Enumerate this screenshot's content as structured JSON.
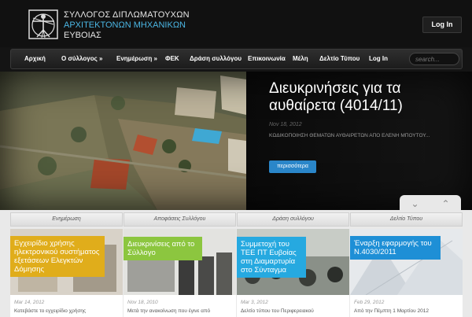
{
  "header": {
    "brand_line1": "ΣΥΛΛΟΓΟΣ ΔΙΠΛΩΜΑΤΟΥΧΩΝ",
    "brand_line2": "ΑΡΧΙΤΕΚΤΟΝΩΝ ΜΗΧΑΝΙΚΩΝ",
    "brand_line3": "ΕΥΒΟΙΑΣ",
    "login_label": "Log In"
  },
  "nav": {
    "items": [
      {
        "label": "Αρχική"
      },
      {
        "label": "Ο σύλλογος »"
      },
      {
        "label": "Ενημέρωση »"
      },
      {
        "label": "ΦΕΚ"
      },
      {
        "label": "Δράση συλλόγου"
      },
      {
        "label": "Επικοινωνία"
      },
      {
        "label": "Μέλη"
      },
      {
        "label": "Δελτίο Τύπου"
      },
      {
        "label": "Log In"
      }
    ],
    "search_placeholder": "search..."
  },
  "hero": {
    "title": "Διευκρινήσεις για τα αυθαίρετα (4014/11)",
    "date": "Nov 18, 2012",
    "excerpt": "ΚΩΔΙΚΟΠΟΙΗΣΗ ΘΕΜΑΤΩΝ ΑΥΘΑΙΡΕΤΩΝ ΑΠΟ ΕΛΕΝΗ ΜΠΟΥΤΟΥ...",
    "more_label": "περισσότερα"
  },
  "tabs": [
    {
      "label": "Ενημέρωση"
    },
    {
      "label": "Αποφάσεις Συλλόγου"
    },
    {
      "label": "Δράση συλλόγου"
    },
    {
      "label": "Δελτίο Τύπου"
    }
  ],
  "cards": [
    {
      "label": "Εγχειρίδιο χρήσης ηλεκτρονικού συστήματος εξετάσεων Ελεγκτών Δόμησης",
      "date": "Mar 14, 2012",
      "excerpt": "Κατεβάστε το εγχειρίδιο χρήσης",
      "color": "#e0ad1b"
    },
    {
      "label": "Διευκρινίσεις από το Σύλλογο",
      "date": "Nov 18, 2010",
      "excerpt": "Μετά την ανακοίνωση που έγινε από",
      "color": "#8cc63f"
    },
    {
      "label": "Συμμετοχή του ΤΕΕ ΠΤ Ευβοίας στη Διαμαρτυρία στο Σύνταγμα",
      "date": "Mar 3, 2012",
      "excerpt": "Δελτίο τύπου του Περιφερειακού",
      "color": "#26a9e0"
    },
    {
      "label": "Έναρξη εφαρμογής του Ν.4030/2011",
      "date": "Feb 29, 2012",
      "excerpt": "Από την Πέμπτη 1 Μαρτίου 2012",
      "color": "#1e8fd6"
    }
  ],
  "colors": {
    "accent": "#2a86c9",
    "brand_blue": "#4bb6e4"
  }
}
